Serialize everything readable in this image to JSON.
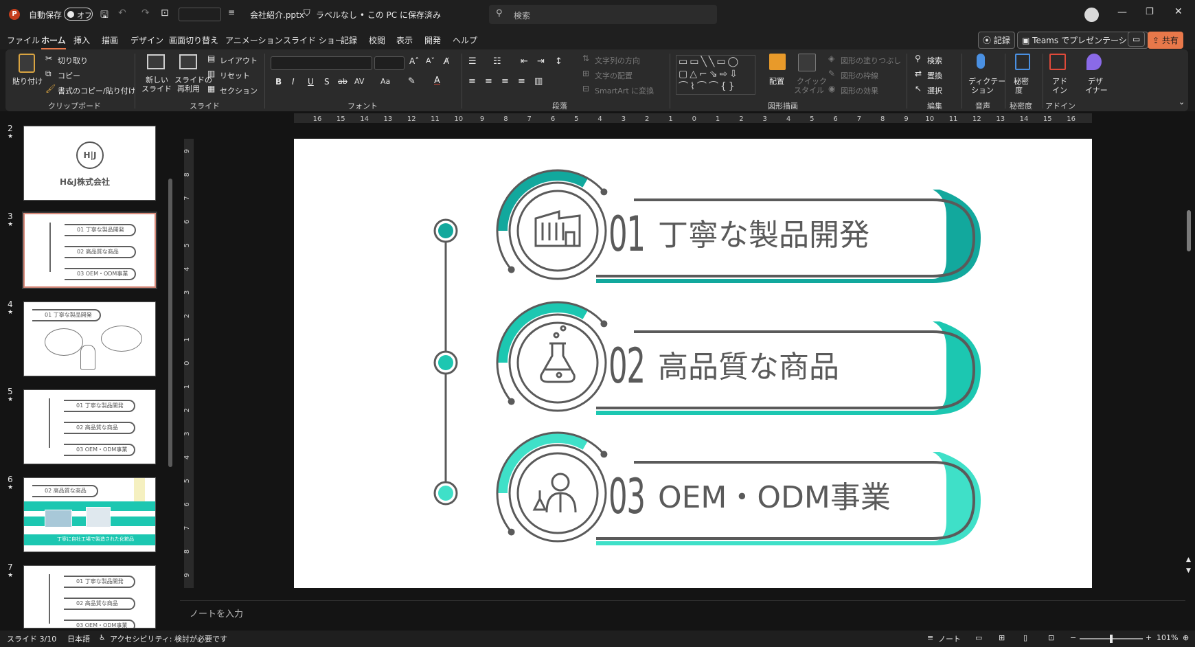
{
  "titlebar": {
    "autosave_label": "自動保存",
    "autosave_state": "オフ",
    "filename": "会社紹介.pptx",
    "label_status": "ラベルなし • この PC に保存済み",
    "search_placeholder": "検索"
  },
  "menu": {
    "tabs": [
      "ファイル",
      "ホーム",
      "挿入",
      "描画",
      "デザイン",
      "画面切り替え",
      "アニメーション",
      "スライド ショー",
      "記録",
      "校閲",
      "表示",
      "開発",
      "ヘルプ"
    ],
    "record_btn": "記録",
    "teams_btn": "Teams でプレゼンテーション",
    "share_btn": "共有"
  },
  "ribbon": {
    "paste": "貼り付け",
    "cut": "切り取り",
    "copy": "コピー",
    "format_painter": "書式のコピー/貼り付け",
    "clipboard_group": "クリップボード",
    "new_slide_1": "新しい",
    "new_slide_2": "スライド",
    "reuse_1": "スライドの",
    "reuse_2": "再利用",
    "layout": "レイアウト",
    "reset": "リセット",
    "section": "セクション",
    "slide_group": "スライド",
    "font_group": "フォント",
    "text_direction": "文字列の方向",
    "align_text": "文字の配置",
    "smartart": "SmartArt に変換",
    "paragraph_group": "段落",
    "arrange": "配置",
    "quick_style_1": "クイック",
    "quick_style_2": "スタイル",
    "shape_fill": "図形の塗りつぶし",
    "shape_outline": "図形の枠線",
    "shape_effects": "図形の効果",
    "drawing_group": "図形描画",
    "find": "検索",
    "replace": "置換",
    "select": "選択",
    "editing_group": "編集",
    "dictate_1": "ディクテー",
    "dictate_2": "ション",
    "voice_group": "音声",
    "sensitivity_1": "秘密",
    "sensitivity_2": "度",
    "sensitivity_group": "秘密度",
    "addin_1": "アド",
    "addin_2": "イン",
    "addin_group": "アドイン",
    "designer_1": "デザ",
    "designer_2": "イナー"
  },
  "thumbnails": {
    "numbers": [
      "2",
      "3",
      "4",
      "5",
      "6",
      "7"
    ],
    "slide2_company": "H&J株式会社",
    "items": [
      "01 丁寧な製品開発",
      "02 高品質な商品",
      "03 OEM・ODM事業"
    ],
    "slide6_title": "02 高品質な商品",
    "slide6_banner": "丁寧に自社工場で製造された化粧品",
    "slide4_title": "01 丁寧な製品開発"
  },
  "slide": {
    "items": [
      {
        "num": "01",
        "title": "丁寧な製品開発",
        "icon": "factory-icon"
      },
      {
        "num": "02",
        "title": "高品質な商品",
        "icon": "flask-icon"
      },
      {
        "num": "03",
        "title": "OEM・ODM事業",
        "icon": "scientist-icon"
      }
    ],
    "colors": {
      "teal_dark": "#12a89d",
      "teal_mid": "#1cc7b1",
      "teal_light": "#3fe0c8",
      "gray": "#5a5a5a"
    }
  },
  "ruler": {
    "h_ticks": [
      "16",
      "15",
      "14",
      "13",
      "12",
      "11",
      "10",
      "9",
      "8",
      "7",
      "6",
      "5",
      "4",
      "3",
      "2",
      "1",
      "0",
      "1",
      "2",
      "3",
      "4",
      "5",
      "6",
      "7",
      "8",
      "9",
      "10",
      "11",
      "12",
      "13",
      "14",
      "15",
      "16"
    ],
    "v_ticks": [
      "9",
      "8",
      "7",
      "6",
      "5",
      "4",
      "3",
      "2",
      "1",
      "0",
      "1",
      "2",
      "3",
      "4",
      "5",
      "6",
      "7",
      "8",
      "9"
    ]
  },
  "notes_placeholder": "ノートを入力",
  "status": {
    "slide_pos": "スライド 3/10",
    "language": "日本語",
    "accessibility": "アクセシビリティ: 検討が必要です",
    "notes": "ノート",
    "zoom": "101%"
  }
}
